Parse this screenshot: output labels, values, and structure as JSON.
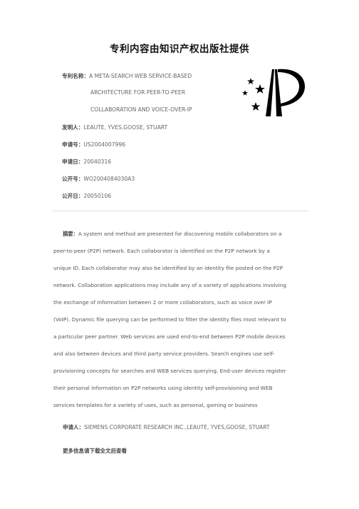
{
  "header": {
    "title": "专利内容由知识产权出版社提供"
  },
  "meta": {
    "patent_name": {
      "label": "专利名称：",
      "lines": [
        "A META-SEARCH WEB SERVICE-BASED",
        "ARCHITECTURE FOR PEER-TO-PEER",
        "COLLABORATION AND VOICE-OVER-IP"
      ]
    },
    "inventor": {
      "label": "发明人：",
      "value": "LEAUTE, YVES,GOOSE, STUART"
    },
    "application_number": {
      "label": "申请号：",
      "value": "US2004007996"
    },
    "application_date": {
      "label": "申请日：",
      "value": "20040316"
    },
    "publication_number": {
      "label": "公开号：",
      "value": "WO2004084030A3"
    },
    "publication_date": {
      "label": "公开日：",
      "value": "20050106"
    }
  },
  "logo": {
    "icon": "cnipa-logo-icon"
  },
  "abstract": {
    "label": "摘要：",
    "lines": [
      "A system and method are presented for discovering mobile collaborators on a",
      "peer-to-peer (P2P) network. Each collaborator is identified on the P2P network by a",
      "unique ID. Each collaborator may also be identified by an identity file posted on the P2P",
      "network. Collaboration applications may include any of a variety of applications involving",
      "the exchange of information between 2 or more collaborators, such as voice over IP",
      "(VoIP). Dynamic file querying can be performed to filter the identity files most relevant to",
      "a particular peer partner. Web services are used end-to-end between P2P mobile devices",
      "and also between devices and third party service providers. Search engines use self-",
      "provisioning concepts for searches and WEB services querying. End-user devices register",
      "their personal information on P2P networks using identity self-provisioning and WEB",
      "services templates for a variety of uses, such as personal, gaming or business"
    ]
  },
  "applicant": {
    "label": "申请人：",
    "value": "SIEMENS CORPORATE RESEARCH INC.,LEAUTE, YVES,GOOSE, STUART"
  },
  "footer": {
    "more_info": "更多信息请下载全文后查看"
  }
}
